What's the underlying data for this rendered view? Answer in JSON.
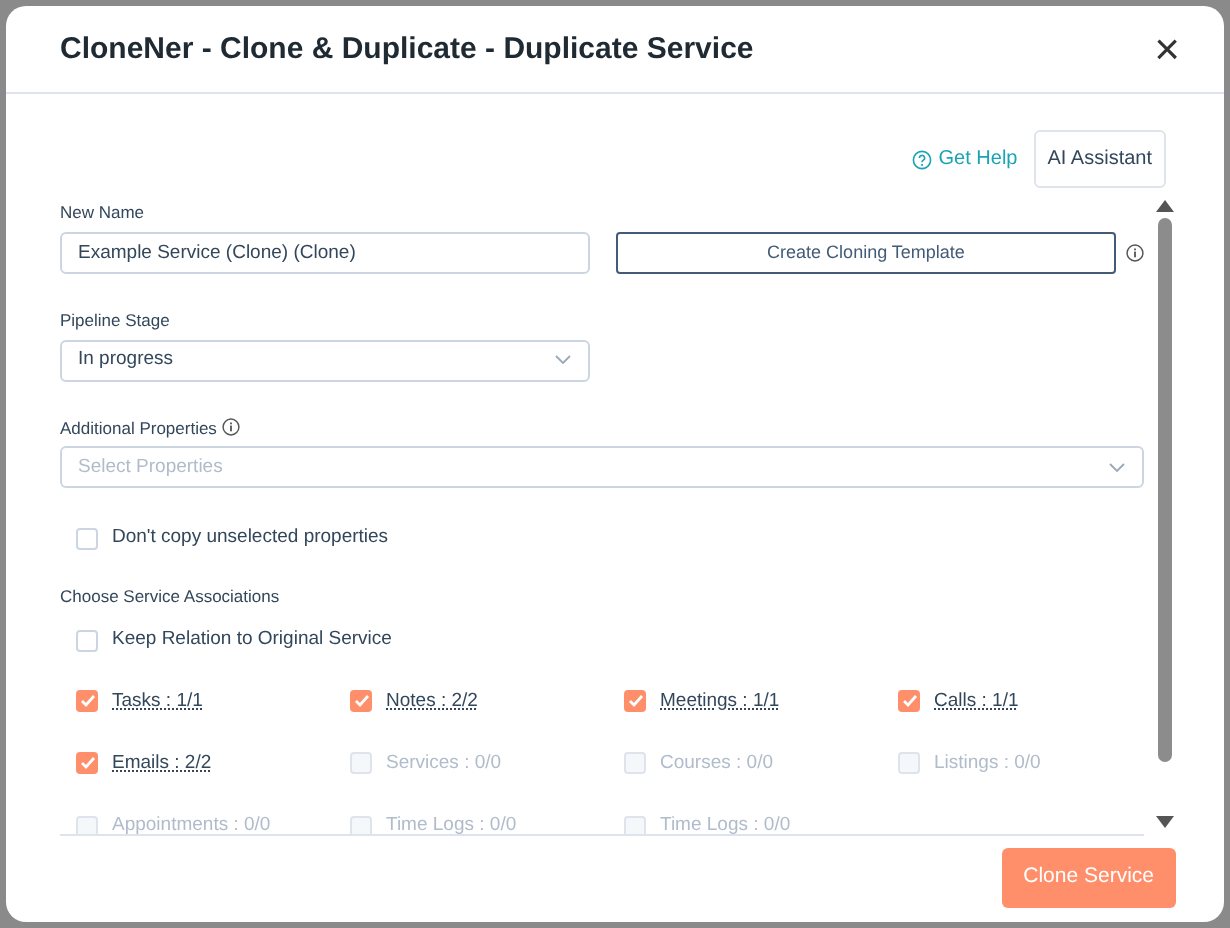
{
  "dialog": {
    "title": "CloneNer - Clone & Duplicate - Duplicate Service",
    "close": "×"
  },
  "help_link": "Get Help",
  "ai_button": "AI Assistant",
  "new_name": {
    "label": "New Name",
    "value": "Example Service (Clone) (Clone)"
  },
  "template_button": "Create Cloning Template",
  "pipeline_stage": {
    "label": "Pipeline Stage",
    "value": "In progress"
  },
  "additional_properties": {
    "label": "Additional Properties",
    "placeholder": "Select Properties"
  },
  "dont_copy": {
    "label": "Don't copy unselected properties",
    "checked": false
  },
  "associations_label": "Choose Service Associations",
  "keep_relation": {
    "label": "Keep Relation to Original Service",
    "checked": false
  },
  "associations": [
    {
      "label": "Tasks : 1/1",
      "checked": true,
      "disabled": false
    },
    {
      "label": "Notes : 2/2",
      "checked": true,
      "disabled": false
    },
    {
      "label": "Meetings : 1/1",
      "checked": true,
      "disabled": false
    },
    {
      "label": "Calls : 1/1",
      "checked": true,
      "disabled": false
    },
    {
      "label": "Emails : 2/2",
      "checked": true,
      "disabled": false
    },
    {
      "label": "Services : 0/0",
      "checked": false,
      "disabled": true
    },
    {
      "label": "Courses : 0/0",
      "checked": false,
      "disabled": true
    },
    {
      "label": "Listings : 0/0",
      "checked": false,
      "disabled": true
    },
    {
      "label": "Appointments : 0/0",
      "checked": false,
      "disabled": true
    },
    {
      "label": "Time Logs : 0/0",
      "checked": false,
      "disabled": true
    },
    {
      "label": "Time Logs : 0/0",
      "checked": false,
      "disabled": true
    }
  ],
  "submit_button": "Clone Service"
}
